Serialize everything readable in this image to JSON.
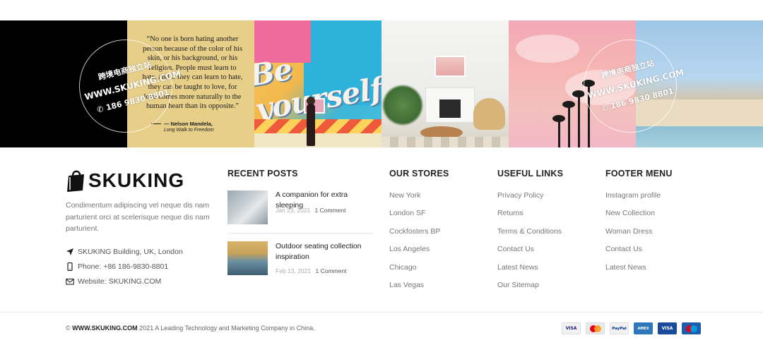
{
  "watermark": {
    "cn": "跨境电商独立站",
    "url": "WWW.SKUKING.COM",
    "phone": "186 9830 8801"
  },
  "instagram": {
    "quote": {
      "text": "“No one is born hating another person because of the color of his skin, or his background, or his religion. People must learn to hate, and if they can learn to hate, they can be taught to love, for love comes more naturally to the human heart than its opposite.”",
      "author": "— Nelson Mandela,",
      "book": "Long Walk to Freedom"
    },
    "art_text": "Be yourself"
  },
  "about": {
    "logo_text": "SKUKING",
    "description": "Condimentum adipiscing vel neque dis nam parturient orci at scelerisque neque dis nam parturient.",
    "address": "SKUKING Building, UK, London",
    "phone": "Phone: +86 186-9830-8801",
    "website": "Website: SKUKING.COM",
    "icons": [
      "location-arrow-icon",
      "mobile-phone-icon",
      "envelope-icon"
    ]
  },
  "recent_posts": {
    "title": "RECENT POSTS",
    "items": [
      {
        "title": "A companion for extra sleeping",
        "date": "Jan 23, 2021",
        "comments": "1 Comment"
      },
      {
        "title": "Outdoor seating collection inspiration",
        "date": "Feb 13, 2021",
        "comments": "1 Comment"
      }
    ]
  },
  "our_stores": {
    "title": "OUR STORES",
    "items": [
      "New York",
      "London SF",
      "Cockfosters BP",
      "Los Angeles",
      "Chicago",
      "Las Vegas"
    ]
  },
  "useful_links": {
    "title": "USEFUL LINKS",
    "items": [
      "Privacy Policy",
      "Returns",
      "Terms & Conditions",
      "Contact Us",
      "Latest News",
      "Our Sitemap"
    ]
  },
  "footer_menu": {
    "title": "FOOTER MENU",
    "items": [
      "Instagram profile",
      "New Collection",
      "Woman Dress",
      "Contact Us",
      "Latest News"
    ]
  },
  "bottom": {
    "copyright_symbol": "©",
    "site": "WWW.SKUKING.COM",
    "text": "2021 A Leading Technology and Marketing Company in China.",
    "payments": [
      {
        "label": "VISA",
        "color": "#1a1f71",
        "bg": "#f2f2f2"
      },
      {
        "label": "MC",
        "color": "#ffffff",
        "bg": "#d9d9d9"
      },
      {
        "label": "PayPal",
        "color": "#003087",
        "bg": "#f2f2f2"
      },
      {
        "label": "AMEX",
        "color": "#ffffff",
        "bg": "#2e77bb"
      },
      {
        "label": "VISA",
        "color": "#ffffff",
        "bg": "#1a4b9b"
      },
      {
        "label": "Maestro",
        "color": "#ffffff",
        "bg": "#1c5cad"
      }
    ]
  }
}
